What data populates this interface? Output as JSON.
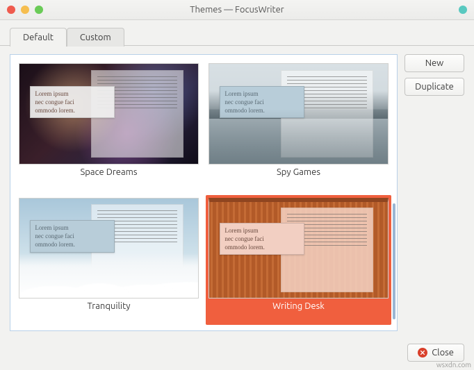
{
  "window": {
    "title": "Themes — FocusWriter"
  },
  "tabs": {
    "default": "Default",
    "custom": "Custom",
    "active": "default"
  },
  "buttons": {
    "new": "New",
    "duplicate": "Duplicate",
    "close": "Close"
  },
  "lorem": {
    "l1": "Lorem ipsum",
    "l2": "nec congue faci",
    "l3": "ommodo lorem."
  },
  "themes": [
    {
      "id": "space-dreams",
      "label": "Space Dreams",
      "selected": false,
      "bg": "bg-space",
      "popup_style": "",
      "doc_style": ""
    },
    {
      "id": "spy-games",
      "label": "Spy Games",
      "selected": false,
      "bg": "bg-spy",
      "popup_style": "blue",
      "doc_style": ""
    },
    {
      "id": "tranquility",
      "label": "Tranquility",
      "selected": false,
      "bg": "bg-tranq",
      "popup_style": "blue",
      "doc_style": ""
    },
    {
      "id": "writing-desk",
      "label": "Writing Desk",
      "selected": true,
      "bg": "bg-desk",
      "popup_style": "pink",
      "doc_style": "pink"
    }
  ],
  "watermark": "wsxdn.com"
}
